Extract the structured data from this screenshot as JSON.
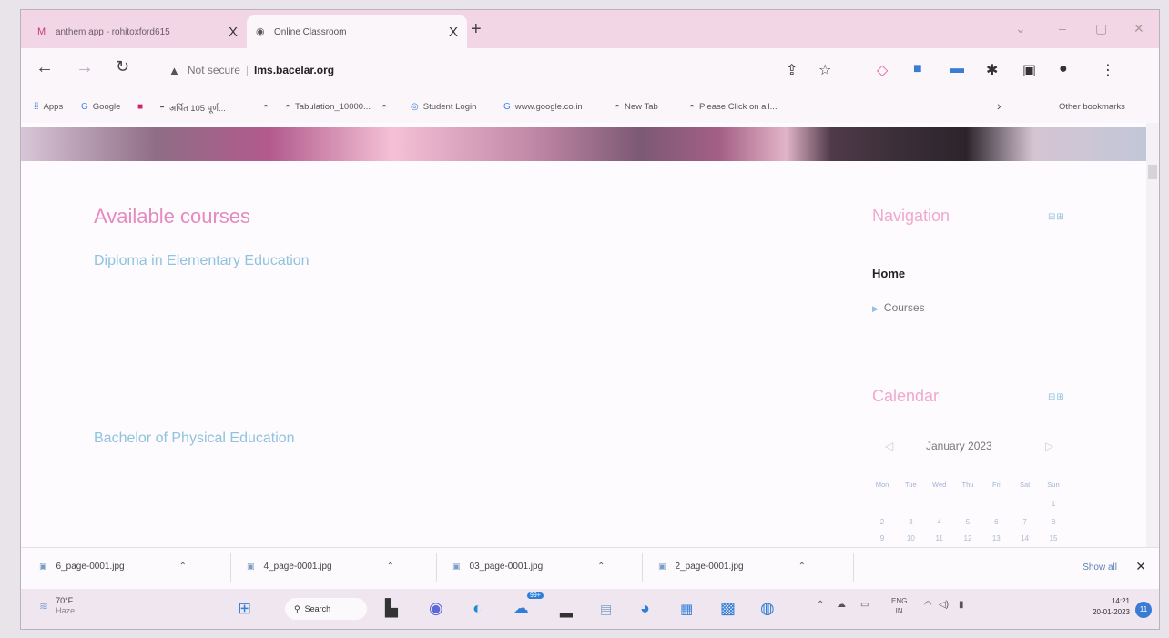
{
  "tabs": [
    {
      "title": "anthem app - rohitoxford615",
      "close": "X",
      "favicon": "gmail-icon"
    },
    {
      "title": "Online Classroom",
      "close": "X",
      "favicon": "globe-icon"
    }
  ],
  "new_tab": "+",
  "window_controls": [
    "⌄",
    "–",
    "▢",
    "✕"
  ],
  "omnibox": {
    "warning": "Not secure",
    "separator": "|",
    "url": "lms.bacelar.org"
  },
  "bookmarks": [
    {
      "label": "Apps",
      "icon": "apps-grid-icon"
    },
    {
      "label": "Google",
      "icon": "google-icon"
    },
    {
      "label": "",
      "icon": "youtube-icon"
    },
    {
      "label": "अर्पित 105 पूर्ण...",
      "icon": "site-icon"
    },
    {
      "label": "",
      "icon": "site-icon"
    },
    {
      "label": "Tabulation_10000...",
      "icon": "site-icon"
    },
    {
      "label": "",
      "icon": "site-icon"
    },
    {
      "label": "Student Login",
      "icon": "chrome-icon"
    },
    {
      "label": "www.google.co.in",
      "icon": "google-icon"
    },
    {
      "label": "New Tab",
      "icon": "site-icon"
    },
    {
      "label": "Please Click on all...",
      "icon": "site-icon"
    }
  ],
  "bookmarks_more": "›",
  "other_bookmarks": "Other bookmarks",
  "main": {
    "heading": "Available courses",
    "courses": [
      "Diploma in Elementary Education",
      "Bachelor of Physical Education"
    ]
  },
  "navigation": {
    "title": "Navigation",
    "controls": "⊟⊞",
    "home": "Home",
    "courses": "Courses"
  },
  "calendar": {
    "title": "Calendar",
    "controls": "⊟⊞",
    "prev": "◁",
    "next": "▷",
    "month": "January 2023",
    "days": [
      "Mon",
      "Tue",
      "Wed",
      "Thu",
      "Fri",
      "Sat",
      "Sun"
    ],
    "rows": [
      [
        "",
        "",
        "",
        "",
        "",
        "",
        "1"
      ],
      [
        "2",
        "3",
        "4",
        "5",
        "6",
        "7",
        "8"
      ],
      [
        "9",
        "10",
        "11",
        "12",
        "13",
        "14",
        "15"
      ]
    ]
  },
  "downloads": [
    {
      "file": "6_page-0001.jpg"
    },
    {
      "file": "4_page-0001.jpg"
    },
    {
      "file": "03_page-0001.jpg"
    },
    {
      "file": "2_page-0001.jpg"
    }
  ],
  "downloads_show_all": "Show all",
  "downloads_close": "✕",
  "taskbar": {
    "temp": "70°F",
    "condition": "Haze",
    "search": "Search",
    "lang_top": "ENG",
    "lang_bottom": "IN",
    "time": "14:21",
    "date": "20-01-2023",
    "badge": "99+",
    "notifications": "11"
  }
}
